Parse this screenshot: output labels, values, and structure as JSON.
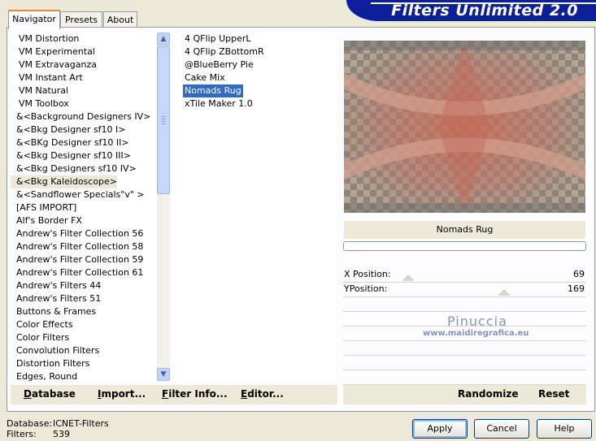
{
  "tabs": [
    "Navigator",
    "Presets",
    "About"
  ],
  "title": "Filters Unlimited 2.0",
  "categories": [
    "VM Distortion",
    "VM Experimental",
    "VM Extravaganza",
    "VM Instant Art",
    "VM Natural",
    "VM Toolbox",
    "&<Background Designers IV>",
    "&<Bkg Designer sf10 I>",
    "&<BKg Designer sf10 II>",
    "&<Bkg Designer sf10 III>",
    "&<Bkg Designers sf10 IV>",
    "&<Bkg Kaleidoscope>",
    "&<Sandflower Specials\"v\" >",
    "[AFS IMPORT]",
    "Alf's Border FX",
    "Andrew's Filter Collection 56",
    "Andrew's Filter Collection 58",
    "Andrew's Filter Collection 59",
    "Andrew's Filter Collection 61",
    "Andrew's Filters 44",
    "Andrew's Filters 51",
    "Buttons & Frames",
    "Color Effects",
    "Color Filters",
    "Convolution Filters",
    "Distortion Filters",
    "Edges, Round"
  ],
  "filters": [
    "4 QFlip UpperL",
    "4 QFlip ZBottomR",
    "@BlueBerry Pie",
    "Cake Mix",
    "Nomads Rug",
    "xTile Maker 1.0"
  ],
  "selected_filter": "Nomads Rug",
  "preview": {
    "filter_name": "Nomads Rug",
    "watermark": "Pinuccia",
    "watermark_url": "www.maidiregrafica.eu"
  },
  "params": [
    {
      "label": "X Position:",
      "value": "69"
    },
    {
      "label": "YPosition:",
      "value": "169"
    }
  ],
  "panel_buttons": [
    "Database",
    "Import...",
    "Filter Info...",
    "Editor...",
    "Randomize",
    "Reset"
  ],
  "status": {
    "db_label": "Database:",
    "db_value": "ICNET-Filters",
    "f_label": "Filters:",
    "f_value": "539"
  },
  "dialog_buttons": [
    "Apply",
    "Cancel",
    "Help"
  ]
}
